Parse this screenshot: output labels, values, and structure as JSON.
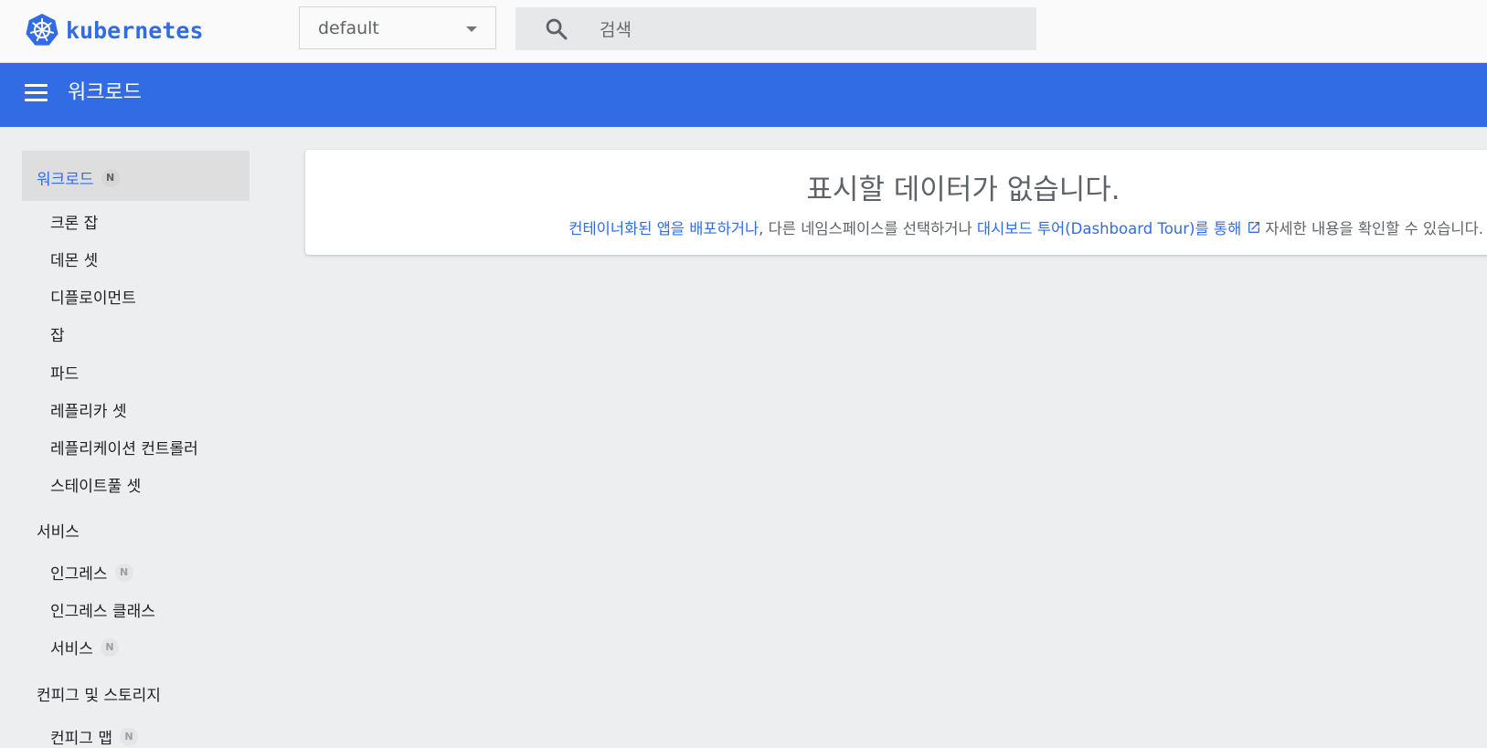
{
  "app": {
    "logo_text": "kubernetes",
    "brand_color": "#326ce5"
  },
  "namespace": {
    "selected": "default"
  },
  "search": {
    "placeholder": "검색",
    "icon": "search-icon"
  },
  "header": {
    "title": "워크로드",
    "menu_icon": "menu-icon"
  },
  "sidebar": {
    "workloads": {
      "label": "워크로드",
      "badge": "N"
    },
    "workload_items": [
      {
        "label": "크론 잡"
      },
      {
        "label": "데몬 셋"
      },
      {
        "label": "디플로이먼트"
      },
      {
        "label": "잡"
      },
      {
        "label": "파드"
      },
      {
        "label": "레플리카 셋"
      },
      {
        "label": "레플리케이션 컨트롤러"
      },
      {
        "label": "스테이트풀 셋"
      }
    ],
    "services": {
      "label": "서비스"
    },
    "service_items": [
      {
        "label": "인그레스",
        "badge": "N"
      },
      {
        "label": "인그레스 클래스"
      },
      {
        "label": "서비스",
        "badge": "N"
      }
    ],
    "config": {
      "label": "컨피그 및 스토리지"
    },
    "config_items": [
      {
        "label": "컨피그 맵",
        "badge": "N"
      }
    ]
  },
  "main": {
    "empty_title": "표시할 데이터가 없습니다.",
    "deploy_link": "컨테이너화된 앱을 배포하거나",
    "middle_text": ", 다른 네임스페이스를 선택하거나 ",
    "tour_link": "대시보드 투어(Dashboard Tour)를 통해",
    "end_text": "자세한 내용을 확인할 수 있습니다."
  }
}
